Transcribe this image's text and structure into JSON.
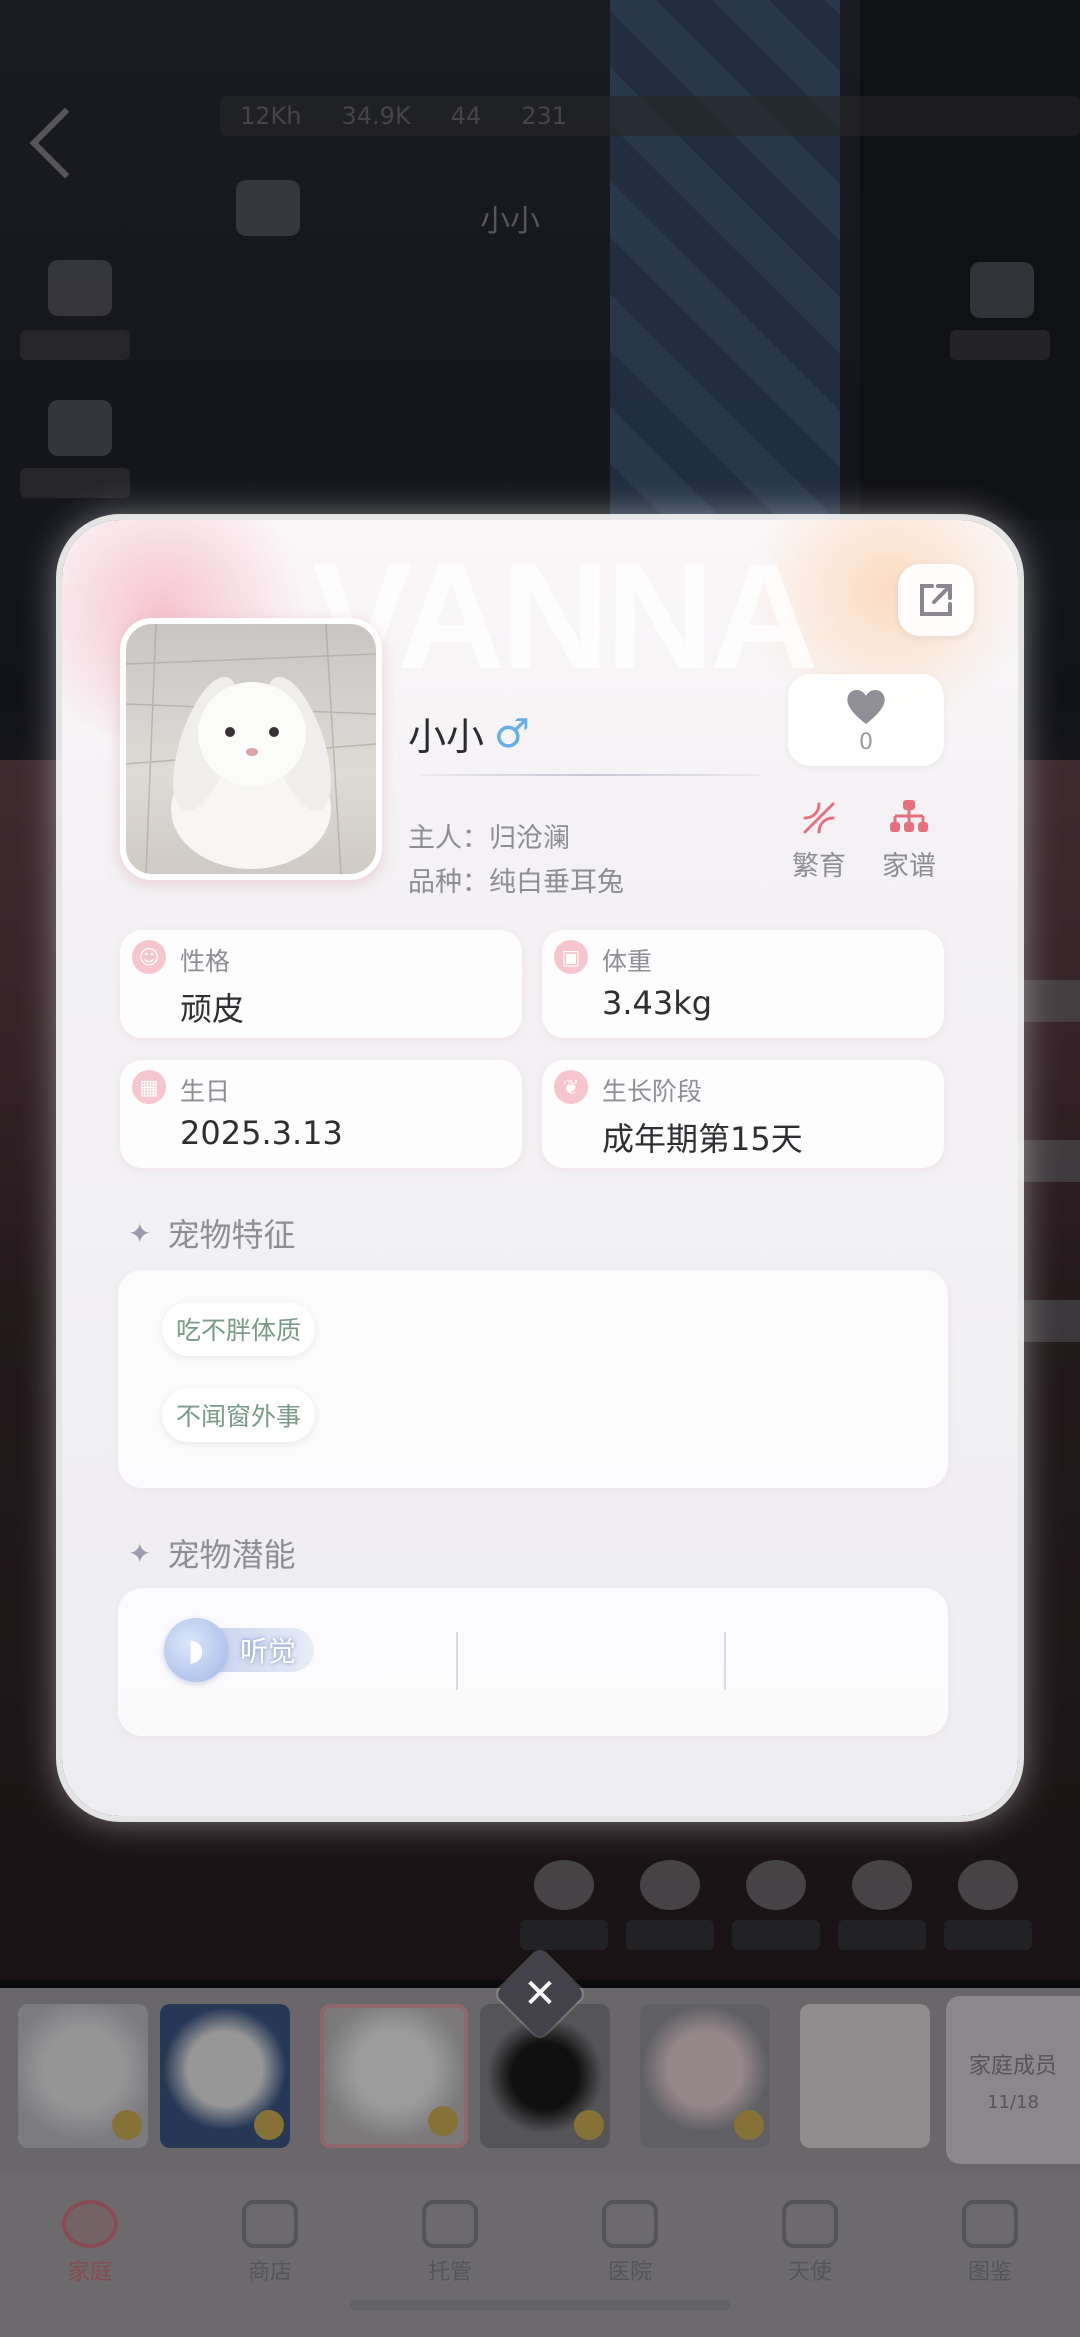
{
  "background": {
    "hud_values": [
      "12Kh",
      "34.9K",
      "44",
      "231"
    ],
    "pet_name": "小小",
    "family_card": {
      "title": "家庭成员",
      "count": "11/18"
    }
  },
  "card": {
    "watermark": "VANNA",
    "pet_name": "小小",
    "gender_symbol": "♂",
    "owner": "主人：归沧澜",
    "breed": "品种：纯白垂耳兔",
    "like_count": "0",
    "actions": {
      "breed": "繁育",
      "family_tree": "家谱"
    },
    "stats": [
      {
        "label": "性格",
        "value": "顽皮",
        "icon": "smile-icon"
      },
      {
        "label": "体重",
        "value": "3.43kg",
        "icon": "scale-icon"
      },
      {
        "label": "生日",
        "value": "2025.3.13",
        "icon": "cake-icon"
      },
      {
        "label": "生长阶段",
        "value": "成年期第15天",
        "icon": "leaf-icon"
      }
    ],
    "traits_title": "宠物特征",
    "traits": [
      "吃不胖体质",
      "不闻窗外事"
    ],
    "potential_title": "宠物潜能",
    "potentials": [
      {
        "label": "听觉",
        "icon": "ear-icon"
      }
    ]
  },
  "bottom_nav": {
    "items": [
      {
        "label": "家庭",
        "active": true
      },
      {
        "label": "商店",
        "active": false
      },
      {
        "label": "托管",
        "active": false
      },
      {
        "label": "医院",
        "active": false
      },
      {
        "label": "天使",
        "active": false
      },
      {
        "label": "图鉴",
        "active": false
      }
    ]
  },
  "colors": {
    "accent_pink": "#d87a86",
    "male_blue": "#66aee8",
    "trait_text": "#7a9a8a"
  }
}
